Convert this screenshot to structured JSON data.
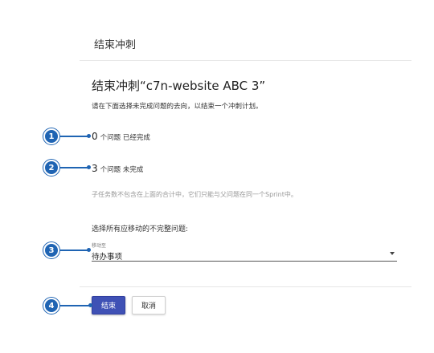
{
  "dialog": {
    "title": "结束冲刺",
    "sprint_heading": "结束冲刺“c7n-website ABC 3”",
    "instruction": "请在下面选择未完成问题的去向，以结束一个冲刺计划。",
    "completed_count": "0",
    "completed_text": "个问题 已经完成",
    "incomplete_count": "3",
    "incomplete_text": "个问题 未完成",
    "note": "子任务数不包含在上面的合计中，它们只能与父问题在同一个Sprint中。",
    "move_prompt": "选择所有应移动的不完整问题:",
    "select": {
      "label": "移动至",
      "value": "待办事项"
    },
    "buttons": {
      "end": "结束",
      "cancel": "取消"
    }
  },
  "callouts": [
    "1",
    "2",
    "3",
    "4"
  ],
  "colors": {
    "primary": "#3f51b5",
    "callout": "#1f64b3"
  }
}
